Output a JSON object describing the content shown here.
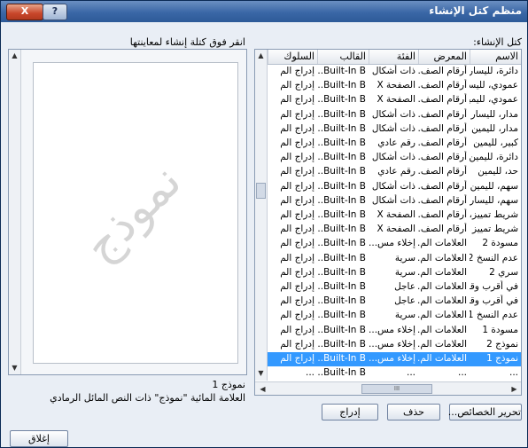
{
  "window": {
    "title": "منظم كتل الإنشاء",
    "close_label": "X",
    "help_label": "?"
  },
  "list_label": "كتل الإنشاء:",
  "preview_label": "انقر فوق كتلة إنشاء لمعاينتها",
  "columns": [
    "الاسم",
    "المعرض",
    "الفئة",
    "القالب",
    "السلوك"
  ],
  "rows": [
    [
      "دائرة، لليسار",
      "أرقام الصف...",
      "ذات أشكال",
      "Built-In B...",
      "إدراج الم"
    ],
    [
      "عمودي، لليسار",
      "أرقام الصف...",
      "الصفحة X",
      "Built-In B...",
      "إدراج الم"
    ],
    [
      "عمودي، لليمين",
      "أرقام الصف...",
      "الصفحة X",
      "Built-In B...",
      "إدراج الم"
    ],
    [
      "مدار، لليسار",
      "أرقام الصف...",
      "ذات أشكال",
      "Built-In B...",
      "إدراج الم"
    ],
    [
      "مدار، لليمين",
      "أرقام الصف...",
      "ذات أشكال",
      "Built-In B...",
      "إدراج الم"
    ],
    [
      "كبير، لليمين",
      "أرقام الصف...",
      "رقم عادي",
      "Built-In B...",
      "إدراج الم"
    ],
    [
      "دائرة، لليمين",
      "أرقام الصف...",
      "ذات أشكال",
      "Built-In B...",
      "إدراج الم"
    ],
    [
      "حد، لليمين",
      "أرقام الصف...",
      "رقم عادي",
      "Built-In B...",
      "إدراج الم"
    ],
    [
      "سهم، لليمين",
      "أرقام الصف...",
      "ذات أشكال",
      "Built-In B...",
      "إدراج الم"
    ],
    [
      "سهم، لليسار",
      "أرقام الصف...",
      "ذات أشكال",
      "Built-In B...",
      "إدراج الم"
    ],
    [
      "شريط تمييز، ...",
      "أرقام الصف...",
      "الصفحة X",
      "Built-In B...",
      "إدراج الم"
    ],
    [
      "شريط تمييز ل...",
      "أرقام الصف...",
      "الصفحة X",
      "Built-In B...",
      "إدراج الم"
    ],
    [
      "مسودة 2",
      "العلامات الم...",
      "إخلاء مس...",
      "Built-In B...",
      "إدراج الم"
    ],
    [
      "عدم النسخ 2",
      "العلامات الم...",
      "سرية",
      "Built-In B...",
      "إدراج الم"
    ],
    [
      "سري 2",
      "العلامات الم...",
      "سرية",
      "Built-In B...",
      "إدراج الم"
    ],
    [
      "في أقرب وقت ...",
      "العلامات الم...",
      "عاجل",
      "Built-In B...",
      "إدراج الم"
    ],
    [
      "في أقرب وقت ...",
      "العلامات الم...",
      "عاجل",
      "Built-In B...",
      "إدراج الم"
    ],
    [
      "عدم النسخ 1",
      "العلامات الم...",
      "سرية",
      "Built-In B...",
      "إدراج الم"
    ],
    [
      "مسودة 1",
      "العلامات الم...",
      "إخلاء مس...",
      "Built-In B...",
      "إدراج الم"
    ],
    [
      "نموذج 2",
      "العلامات الم...",
      "إخلاء مس...",
      "Built-In B...",
      "إدراج الم"
    ],
    [
      "نموذج 1",
      "العلامات الم...",
      "إخلاء مس...",
      "Built-In B...",
      "إدراج الم"
    ],
    [
      "...",
      "...",
      "...",
      "Built-In B...",
      "..."
    ]
  ],
  "selected_row": 20,
  "preview": {
    "watermark": "نموذج",
    "item_name": "نموذج 1",
    "item_desc": "العلامة المائية \"نموذج\" ذات النص المائل الرمادي"
  },
  "buttons": {
    "edit": "تحرير الخصائص...",
    "delete": "حذف",
    "insert": "إدراج",
    "close": "إغلاق"
  },
  "hscroll_glyph": "III"
}
